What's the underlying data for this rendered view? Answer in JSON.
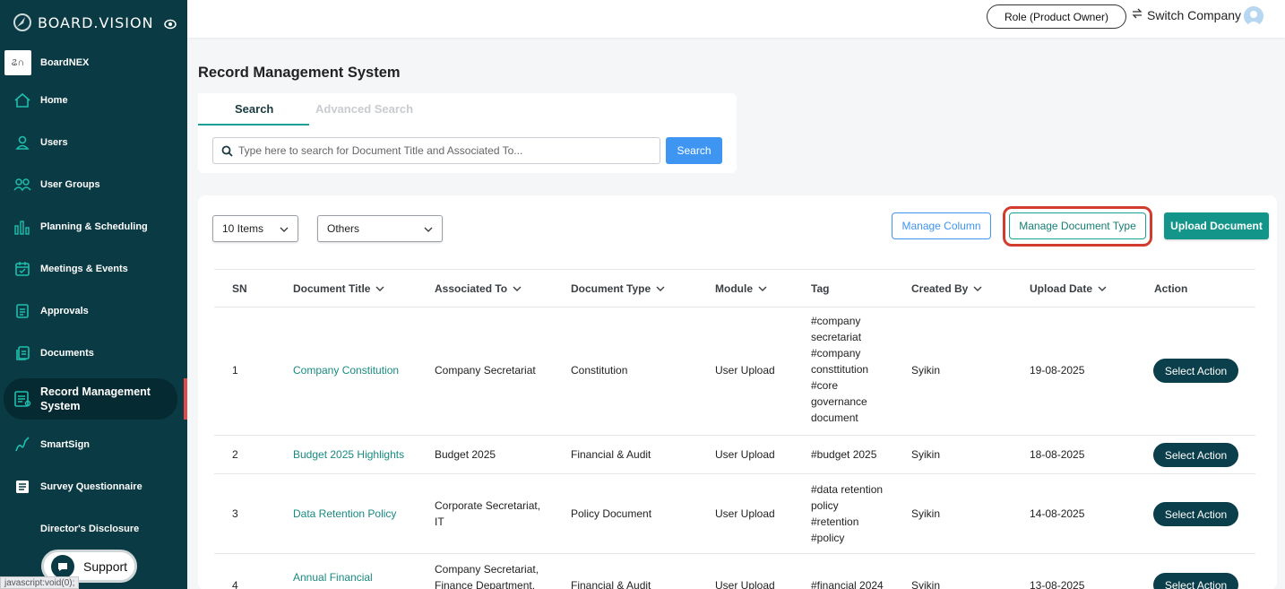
{
  "sidebar": {
    "brand": "BOARD.VISION",
    "company": {
      "logo_text": "ଌ∩",
      "name": "BoardNEX"
    },
    "items": [
      {
        "label": "Home",
        "icon": "home-icon"
      },
      {
        "label": "Users",
        "icon": "user-icon"
      },
      {
        "label": "User Groups",
        "icon": "user-group-icon"
      },
      {
        "label": "Planning & Scheduling",
        "icon": "bar-chart-icon"
      },
      {
        "label": "Meetings & Events",
        "icon": "calendar-icon"
      },
      {
        "label": "Approvals",
        "icon": "approval-icon"
      },
      {
        "label": "Documents",
        "icon": "documents-icon"
      },
      {
        "label": "Record Management System",
        "icon": "record-icon"
      },
      {
        "label": "SmartSign",
        "icon": "signature-icon"
      },
      {
        "label": "Survey Questionnaire",
        "icon": "survey-icon"
      },
      {
        "label": "Director's Disclosure",
        "icon": ""
      }
    ],
    "support_label": "Support",
    "status_link": "javascript:void(0);"
  },
  "topbar": {
    "role": "Role (Product Owner)",
    "switch_company": "Switch Company"
  },
  "page": {
    "title": "Record Management System"
  },
  "search": {
    "tabs": [
      "Search",
      "Advanced Search"
    ],
    "placeholder": "Type here to search for Document Title and Associated To...",
    "button": "Search"
  },
  "toolbar": {
    "items_select": "10 Items",
    "filter_select": "Others",
    "manage_column": "Manage Column",
    "manage_document_type": "Manage Document Type",
    "upload_document": "Upload Document"
  },
  "table": {
    "columns": [
      "SN",
      "Document Title",
      "Associated To",
      "Document Type",
      "Module",
      "Tag",
      "Created By",
      "Upload Date",
      "Action"
    ],
    "rows": [
      {
        "sn": "1",
        "title": "Company Constitution",
        "associated": "Company Secretariat",
        "type": "Constitution",
        "module": "User Upload",
        "tag": "#company\nsecretariat\n#company\nconsttitution\n#core\ngovernance\ndocument",
        "created_by": "Syikin",
        "date": "19-08-2025",
        "action": "Select Action"
      },
      {
        "sn": "2",
        "title": "Budget 2025 Highlights",
        "associated": "Budget 2025",
        "type": "Financial & Audit",
        "module": "User Upload",
        "tag": "#budget 2025",
        "created_by": "Syikin",
        "date": "18-08-2025",
        "action": "Select Action"
      },
      {
        "sn": "3",
        "title": "Data Retention Policy",
        "associated": "Corporate Secretariat,\nIT",
        "type": "Policy Document",
        "module": "User Upload",
        "tag": "#data retention\npolicy\n#retention\n#policy",
        "created_by": "Syikin",
        "date": "14-08-2025",
        "action": "Select Action"
      },
      {
        "sn": "4",
        "title": "Annual Financial",
        "associated": "Company Secretariat,\nFinance Department,",
        "type": "Financial & Audit",
        "module": "User Upload",
        "tag": "#financial 2024",
        "created_by": "Syikin",
        "date": "13-08-2025",
        "action": "Select Action"
      }
    ]
  },
  "colors": {
    "sidebar": "#0a3a43",
    "accent_teal": "#1aa394",
    "accent_blue": "#3e95f2",
    "highlight_red": "#d13c2e"
  }
}
